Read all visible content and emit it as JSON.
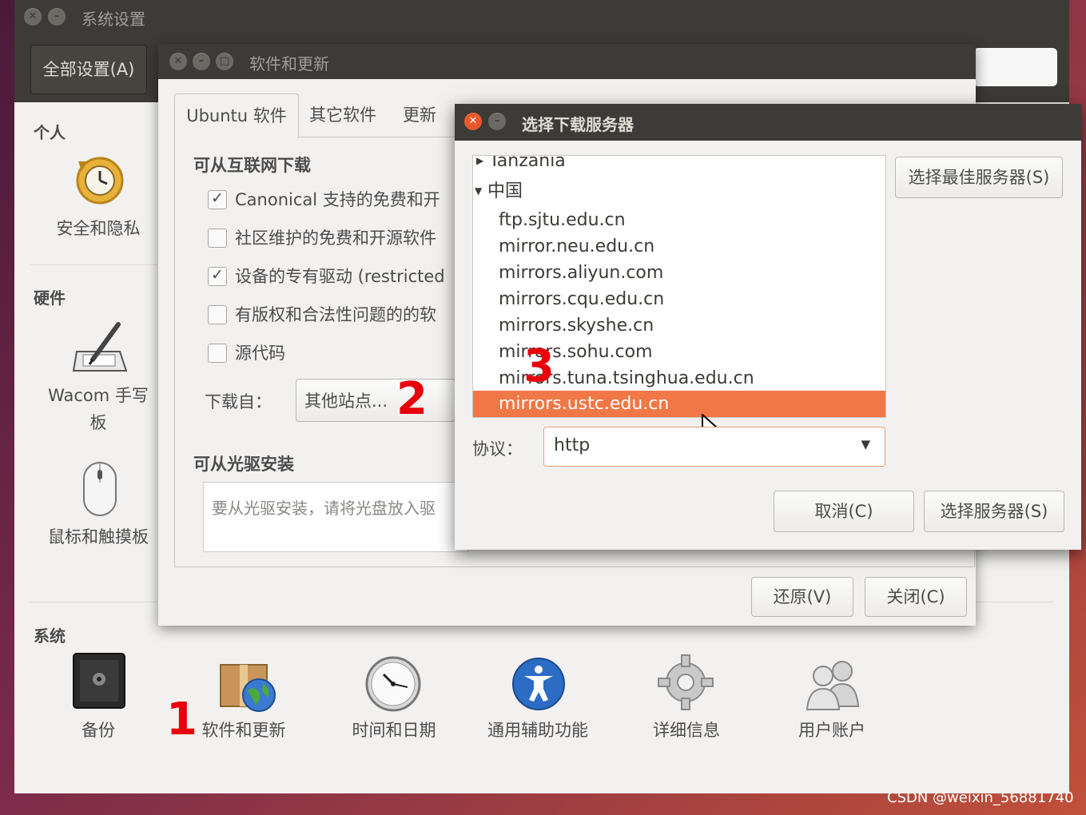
{
  "outer_window": {
    "title": "系统设置",
    "all_settings_label": "全部设置(A)",
    "categories": {
      "personal": "个人",
      "hardware": "硬件",
      "system": "系统"
    },
    "personal_items": [
      {
        "label": "安全和隐私",
        "icon": "clock-restore-icon"
      }
    ],
    "hardware_items": [
      {
        "label": "Wacom 手写\n板",
        "icon": "wacom-tablet-icon"
      },
      {
        "label": "鼠标和触摸板",
        "icon": "mouse-icon"
      }
    ],
    "system_items": [
      {
        "label": "备份",
        "icon": "safe-icon"
      },
      {
        "label": "软件和更新",
        "icon": "package-globe-icon"
      },
      {
        "label": "时间和日期",
        "icon": "clock-icon"
      },
      {
        "label": "通用辅助功能",
        "icon": "accessibility-icon"
      },
      {
        "label": "详细信息",
        "icon": "gear-icon"
      },
      {
        "label": "用户账户",
        "icon": "users-icon"
      }
    ]
  },
  "software_dialog": {
    "title": "软件和更新",
    "tabs": [
      "Ubuntu 软件",
      "其它软件",
      "更新"
    ],
    "internet_section": "可从互联网下载",
    "options": [
      {
        "label": "Canonical 支持的免费和开",
        "checked": true
      },
      {
        "label": "社区维护的免费和开源软件",
        "checked": false
      },
      {
        "label": "设备的专有驱动 (restricted",
        "checked": true
      },
      {
        "label": "有版权和合法性问题的的软",
        "checked": false
      },
      {
        "label": "源代码",
        "checked": false
      }
    ],
    "download_from_label": "下载自：",
    "download_from_value": "其他站点...",
    "cdrom_section": "可从光驱安装",
    "cdrom_hint": "要从光驱安装，请将光盘放入驱",
    "revert_button": "还原(V)",
    "close_button": "关闭(C)"
  },
  "server_dialog": {
    "title": "选择下载服务器",
    "best_server_button": "选择最佳服务器(S)",
    "servers": [
      {
        "label": "Tanzania",
        "type": "country",
        "expanded": false
      },
      {
        "label": "中国",
        "type": "country",
        "expanded": true
      },
      {
        "label": "ftp.sjtu.edu.cn",
        "type": "mirror"
      },
      {
        "label": "mirror.neu.edu.cn",
        "type": "mirror"
      },
      {
        "label": "mirrors.aliyun.com",
        "type": "mirror"
      },
      {
        "label": "mirrors.cqu.edu.cn",
        "type": "mirror"
      },
      {
        "label": "mirrors.skyshe.cn",
        "type": "mirror"
      },
      {
        "label": "mirrors.sohu.com",
        "type": "mirror"
      },
      {
        "label": "mirrors.tuna.tsinghua.edu.cn",
        "type": "mirror"
      },
      {
        "label": "mirrors.ustc.edu.cn",
        "type": "mirror",
        "selected": true
      }
    ],
    "protocol_label": "协议：",
    "protocol_value": "http",
    "cancel_button": "取消(C)",
    "choose_button": "选择服务器(S)"
  },
  "annotations": {
    "step1": "1",
    "step2": "2",
    "step3": "3"
  },
  "watermark": "CSDN @weixin_56881740",
  "colors": {
    "selection": "#f07746",
    "annotation": "#e8000b",
    "titlebar": "#3c3b37"
  }
}
